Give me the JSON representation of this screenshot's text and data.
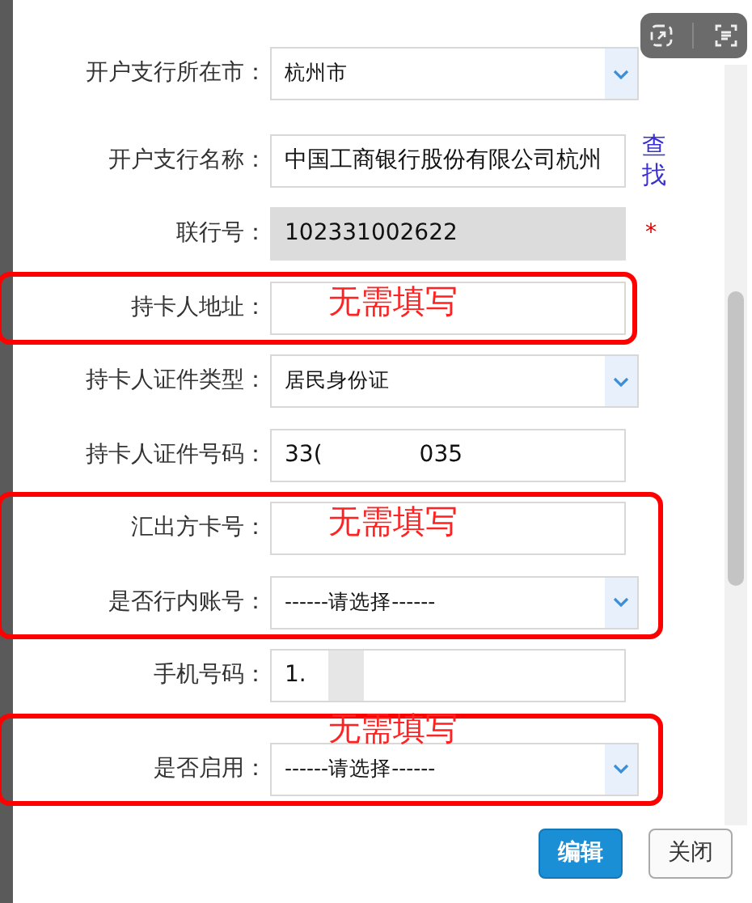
{
  "sections": [
    {
      "fields": [
        {
          "kind": "select",
          "label": "开户支行所在市：",
          "value": "杭州市"
        },
        {
          "kind": "link",
          "label": "开户支行名称：",
          "value": "中国工商银行股份有限公司杭州",
          "link": "查找"
        },
        {
          "kind": "readonly",
          "label": "联行号：",
          "value": "102331002622",
          "required_mark": "*"
        }
      ]
    },
    {
      "annotation": "无需填写",
      "fields": [
        {
          "kind": "input",
          "label": "持卡人地址："
        }
      ]
    },
    {
      "fields": [
        {
          "kind": "select",
          "label": "持卡人证件类型：",
          "value": "居民身份证"
        },
        {
          "kind": "masked",
          "label": "持卡人证件号码：",
          "value_start": "33(",
          "value_end": "035"
        }
      ]
    },
    {
      "annotation": "无需填写",
      "fields": [
        {
          "kind": "input",
          "label": "汇出方卡号："
        },
        {
          "kind": "select",
          "label": "是否行内账号：",
          "value": "------请选择------"
        }
      ]
    },
    {
      "fields": [
        {
          "kind": "masked",
          "label": "手机号码：",
          "value_start": "1."
        }
      ]
    },
    {
      "annotation": "无需填写",
      "fields": [
        {
          "kind": "select",
          "label": "是否启用：",
          "value": "------请选择------"
        }
      ]
    }
  ],
  "buttons": [
    {
      "label": "编辑",
      "kind": "primary"
    },
    {
      "label": "关闭",
      "kind": "secondary"
    }
  ]
}
